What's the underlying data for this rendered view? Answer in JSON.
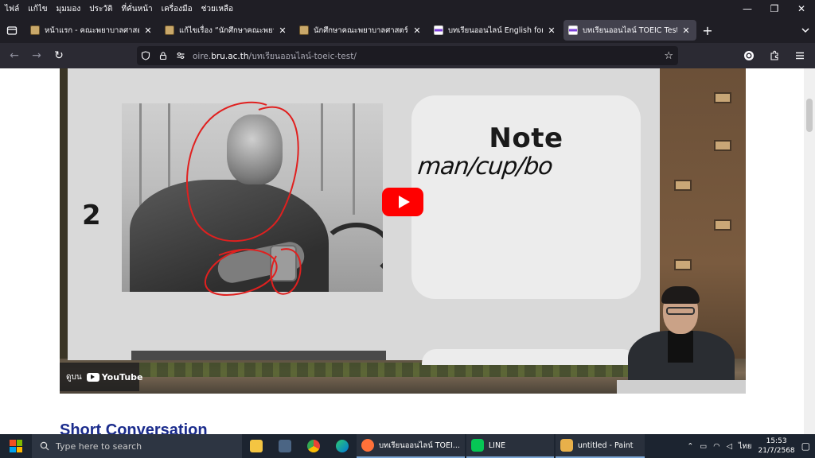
{
  "menubar": {
    "items": [
      "ไฟล์",
      "แก้ไข",
      "มุมมอง",
      "ประวัติ",
      "ที่คั่นหน้า",
      "เครื่องมือ",
      "ช่วยเหลือ"
    ]
  },
  "window_controls": {
    "minimize": "—",
    "maximize": "❐",
    "close": "✕"
  },
  "tabs": [
    {
      "label": "หน้าแรก - คณะพยาบาลศาสตร์",
      "active": false,
      "favicon": "brown"
    },
    {
      "label": "แก้ไขเรื่อง “นักศึกษาคณะพยาบาล",
      "active": false,
      "favicon": "brown"
    },
    {
      "label": "นักศึกษาคณะพยาบาลศาสตร์ สาม",
      "active": false,
      "favicon": "brown"
    },
    {
      "label": "บทเรียนออนไลน์ English for Dail",
      "active": false,
      "favicon": "flag"
    },
    {
      "label": "บทเรียนออนไลน์ TOEIC Test - สำ",
      "active": true,
      "favicon": "flag"
    }
  ],
  "tab_close": "✕",
  "new_tab": "+",
  "navbar": {
    "back": "←",
    "forward": "→",
    "reload": "↻",
    "url_prefix": "oire.",
    "url_host": "bru.ac.th",
    "url_path": "/บทเรียนออนไลน์-toeic-test/",
    "star": "☆"
  },
  "video": {
    "slide_number": "2",
    "note_title": "Note",
    "note_handwriting": "man/cup/bo",
    "watermark_prefix": "ดูบน",
    "watermark_brand": "YouTube",
    "play_color": "#ff0000"
  },
  "page": {
    "section_heading": "Short Conversation"
  },
  "taskbar": {
    "search_placeholder": "Type here to search",
    "apps": [
      {
        "label": "บทเรียนออนไลน์ TOEI...",
        "color": "#ff7139"
      },
      {
        "label": "LINE",
        "color": "#06c755"
      },
      {
        "label": "untitled - Paint",
        "color": "#e8b04a"
      }
    ],
    "tray": {
      "language": "ไทย",
      "time": "15:53",
      "date": "21/7/2568"
    }
  }
}
